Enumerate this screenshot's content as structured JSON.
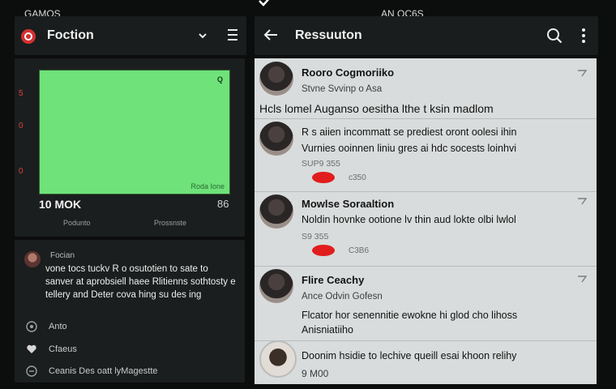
{
  "status": {
    "left": "GAMOS",
    "right": "AN OC6S"
  },
  "left_panel": {
    "header_title": "Foction",
    "video": {
      "badge": "Q",
      "caption": "Roda Ione",
      "side_ticks": [
        "5",
        "0",
        "0"
      ],
      "title": "10 MOK",
      "count": "86",
      "tab_left": "Podunto",
      "tab_right": "Prossnste"
    },
    "comment": {
      "author": "Focian",
      "body": "vone tocs tuckv R o osutotien to sate to sanver at aprobsiell haee Rlitienns sothtosty e tellery and Deter cova hing su des ing",
      "like_label": "Anto",
      "reply_label": "Cfaeus",
      "share_label": "Ceanis Des oatt lyMagestte"
    }
  },
  "right_panel": {
    "header_title": "Ressuuton",
    "results": [
      {
        "name": "Rooro Cogmoriiko",
        "sub": "Stvne Svvinp o Asa",
        "text": "Hcls lomel Auganso oesitha lthe t ksin madlom"
      },
      {
        "name": "R s aiien incommatt se prediest oront oolesi ihin",
        "sub": "Vurnies ooinnen liniu gres ai hdc socests loinhvi",
        "meta_a": "SUP9 355",
        "meta_b": "c350"
      },
      {
        "name": "Mowlse Soraaltion",
        "text": "Noldin hovnke ootione lv thin aud lokte olbi lwlol",
        "meta_a": "S9 355",
        "meta_b": "C3B6"
      },
      {
        "name": "Flire Ceachy",
        "sub": "Ance Odvin Gofesn",
        "text": "Flcator hor senennitie ewokne hi glod cho lihoss",
        "text2": "Anisniatiiho"
      },
      {
        "text": "Doonim hsidie to lechive queill esai khoon relihy",
        "meta_a": "9 M00"
      }
    ]
  }
}
